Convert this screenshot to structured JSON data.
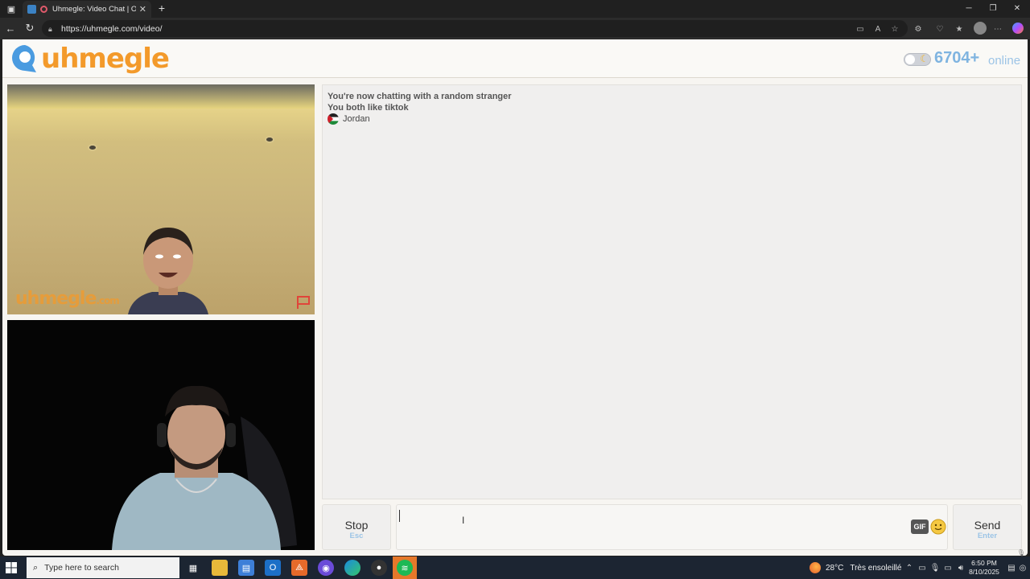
{
  "browser": {
    "tab_title": "Uhmegle: Video Chat | Ome",
    "url": "https://uhmegle.com/video/"
  },
  "header": {
    "logo_text": "uhmegle",
    "online_count": "6704+",
    "online_label": "online"
  },
  "video": {
    "watermark": "uhmegle",
    "watermark_suffix": ".com"
  },
  "chat": {
    "messages": [
      "You're now chatting with a random stranger",
      "You both like tiktok"
    ],
    "country": "Jordan"
  },
  "controls": {
    "stop_label": "Stop",
    "stop_key": "Esc",
    "send_label": "Send",
    "send_key": "Enter",
    "gif_label": "GIF",
    "input_value": ""
  },
  "taskbar": {
    "search_placeholder": "Type here to search",
    "weather_temp": "28°C",
    "weather_desc": "Très ensoleillé",
    "time": "6:50 PM",
    "date": "8/10/2025"
  },
  "colors": {
    "brand_orange": "#f39a2b",
    "online_blue": "#7fb4e0",
    "taskbar_bg": "#1c2532"
  }
}
